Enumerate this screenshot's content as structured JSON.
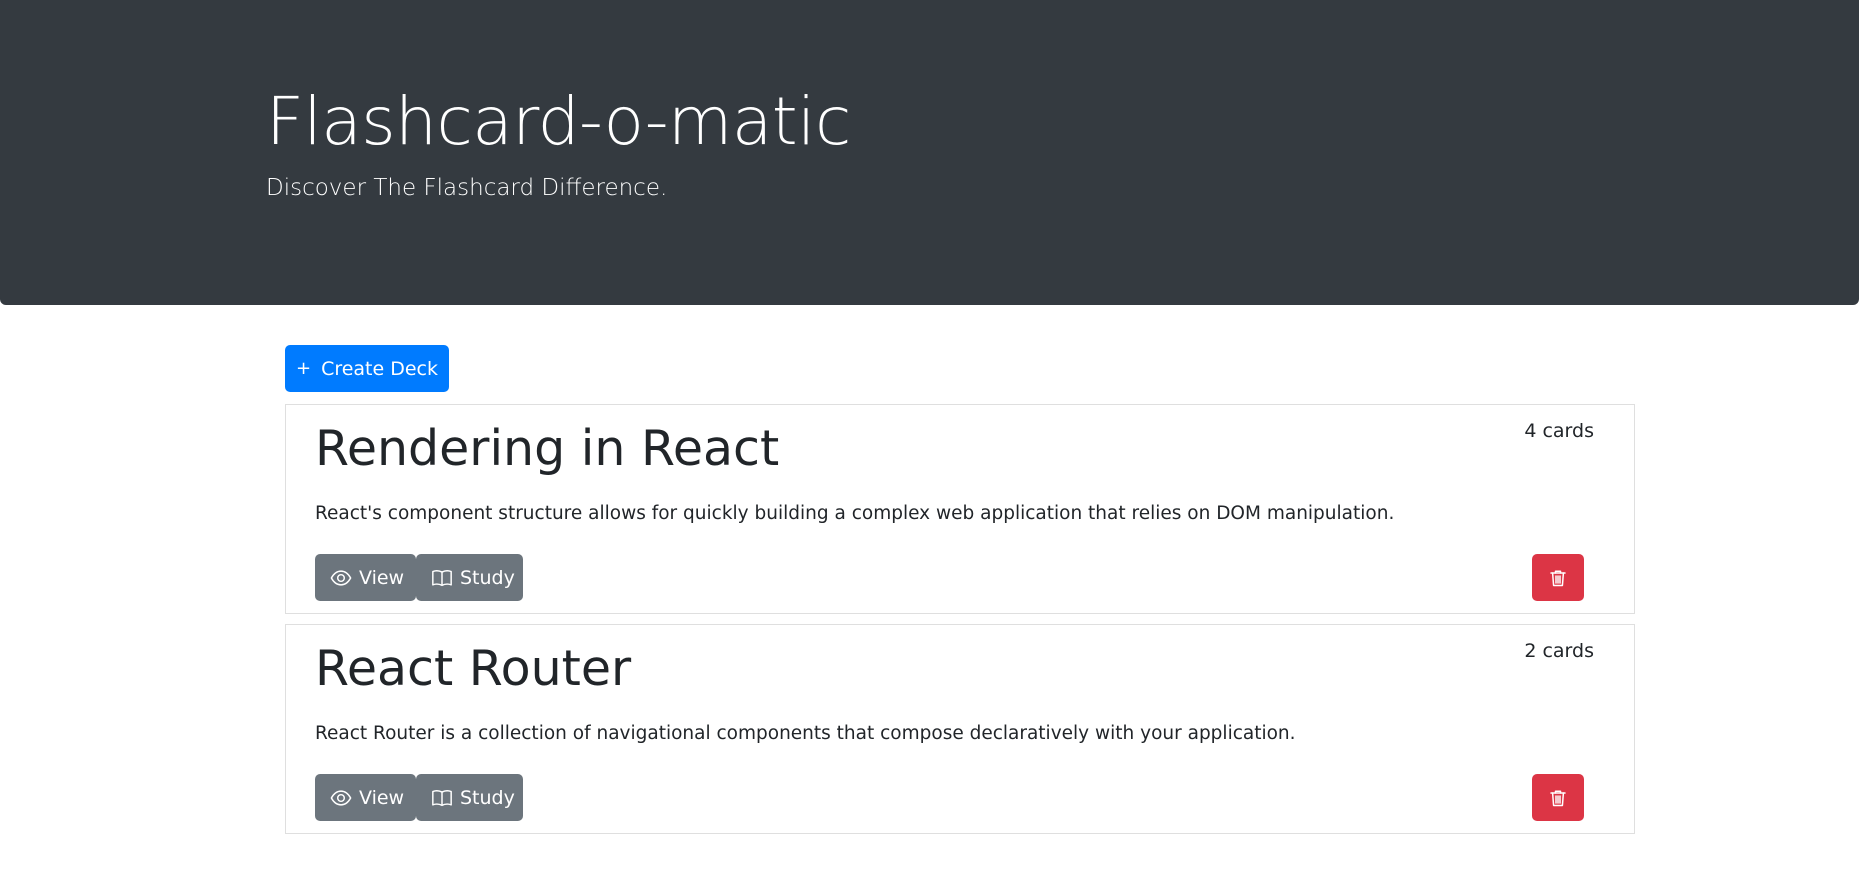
{
  "header": {
    "title": "Flashcard-o-matic",
    "lead": "Discover The Flashcard Difference."
  },
  "toolbar": {
    "create_icon": "+",
    "create_label": "Create Deck"
  },
  "decks": [
    {
      "name": "Rendering in React",
      "count": "4 cards",
      "description": "React's component structure allows for quickly building a complex web application that relies on DOM manipulation.",
      "view_label": "View",
      "study_label": "Study"
    },
    {
      "name": "React Router",
      "count": "2 cards",
      "description": "React Router is a collection of navigational components that compose declaratively with your application.",
      "view_label": "View",
      "study_label": "Study"
    }
  ],
  "colors": {
    "header_bg": "#343a40",
    "primary": "#007bff",
    "secondary": "#6c757d",
    "danger": "#dc3545"
  },
  "icons": {
    "view": "eye-icon",
    "study": "book-icon",
    "delete": "trash-icon",
    "create": "plus-icon"
  }
}
